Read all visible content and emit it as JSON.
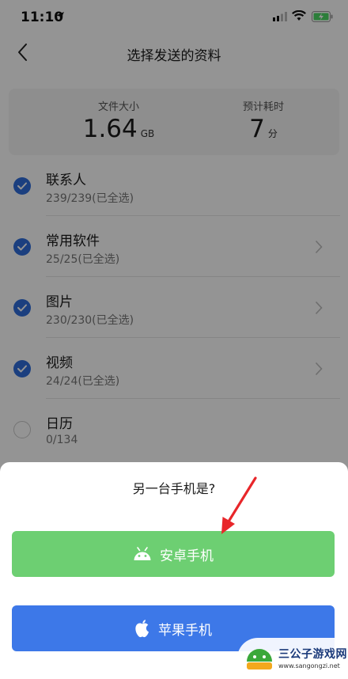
{
  "status_bar": {
    "time": "11:10"
  },
  "header": {
    "title": "选择发送的资料"
  },
  "summary": {
    "size_label": "文件大小",
    "size_value": "1.64",
    "size_unit": "GB",
    "time_label": "预计耗时",
    "time_value": "7",
    "time_unit": "分"
  },
  "items": [
    {
      "title": "联系人",
      "sub": "239/239(已全选)",
      "checked": true,
      "chevron": false
    },
    {
      "title": "常用软件",
      "sub": "25/25(已全选)",
      "checked": true,
      "chevron": true
    },
    {
      "title": "图片",
      "sub": "230/230(已全选)",
      "checked": true,
      "chevron": true
    },
    {
      "title": "视频",
      "sub": "24/24(已全选)",
      "checked": true,
      "chevron": true
    },
    {
      "title": "日历",
      "sub": "0/134",
      "checked": false,
      "chevron": false
    }
  ],
  "sheet": {
    "title": "另一台手机是?",
    "android_label": "安卓手机",
    "apple_label": "苹果手机"
  },
  "watermark": {
    "title": "三公子游戏网",
    "url": "www.sangongzi.net"
  },
  "colors": {
    "accent_blue": "#2f6ddb",
    "android_green": "#6dcf72",
    "apple_blue": "#3d78e8",
    "arrow_red": "#e8262a"
  }
}
